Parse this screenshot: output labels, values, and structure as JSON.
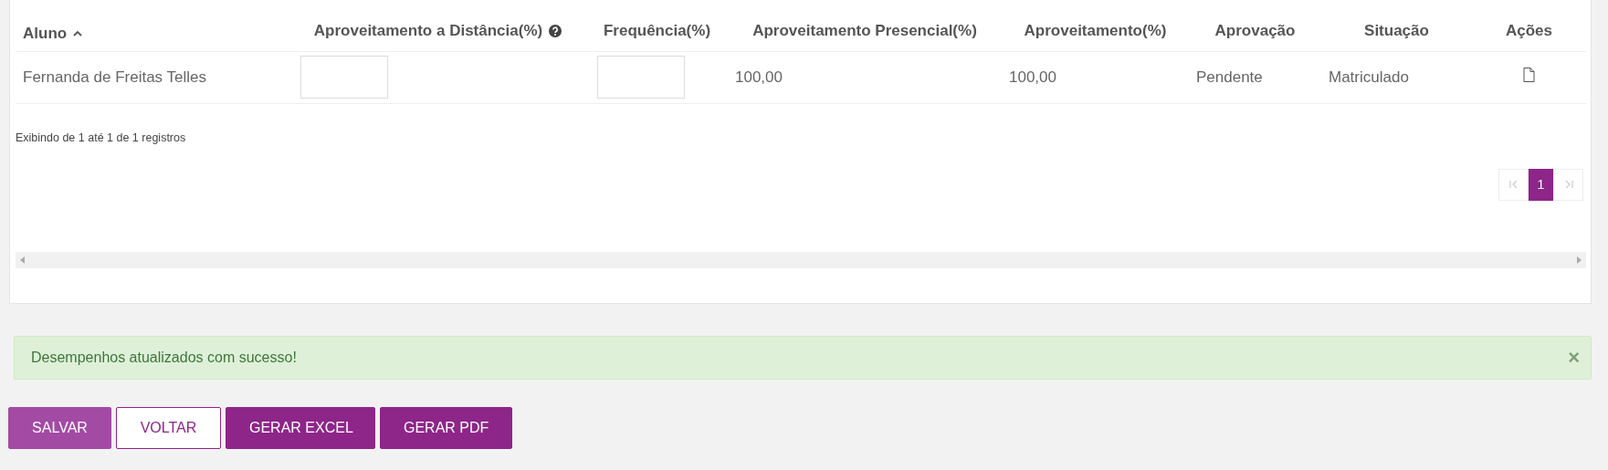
{
  "table": {
    "columns": [
      {
        "label": "Aluno",
        "sorted": true,
        "help": false
      },
      {
        "label": "Aproveitamento a Distância(%)",
        "sorted": false,
        "help": true
      },
      {
        "label": "Frequência(%)",
        "sorted": false,
        "help": false
      },
      {
        "label": "Aproveitamento Presencial(%)",
        "sorted": false,
        "help": false
      },
      {
        "label": "Aproveitamento(%)",
        "sorted": false,
        "help": false
      },
      {
        "label": "Aprovação",
        "sorted": false,
        "help": false
      },
      {
        "label": "Situação",
        "sorted": false,
        "help": false
      },
      {
        "label": "Ações",
        "sorted": false,
        "help": false
      }
    ],
    "rows": [
      {
        "cells": [
          {
            "kind": "text",
            "text": "Fernanda de Freitas Telles"
          },
          {
            "kind": "input"
          },
          {
            "kind": "input"
          },
          {
            "kind": "text",
            "text": "100,00"
          },
          {
            "kind": "text",
            "text": "100,00"
          },
          {
            "kind": "text",
            "text": "Pendente"
          },
          {
            "kind": "text",
            "text": "Matriculado"
          },
          {
            "kind": "action"
          }
        ]
      }
    ]
  },
  "info": "Exibindo de 1 até 1 de 1 registros",
  "pagination": [
    {
      "kind": "first",
      "disabled": true
    },
    {
      "kind": "page",
      "label": "1",
      "selected": true
    },
    {
      "kind": "last",
      "disabled": true
    }
  ],
  "alert": {
    "text": "Desempenhos atualizados com sucesso!",
    "close": "×"
  },
  "buttons": [
    {
      "label": "SALVAR",
      "kind": "light"
    },
    {
      "label": "VOLTAR",
      "kind": "outline"
    },
    {
      "label": "GERAR EXCEL",
      "kind": "solid"
    },
    {
      "label": "GERAR PDF",
      "kind": "solid"
    }
  ]
}
